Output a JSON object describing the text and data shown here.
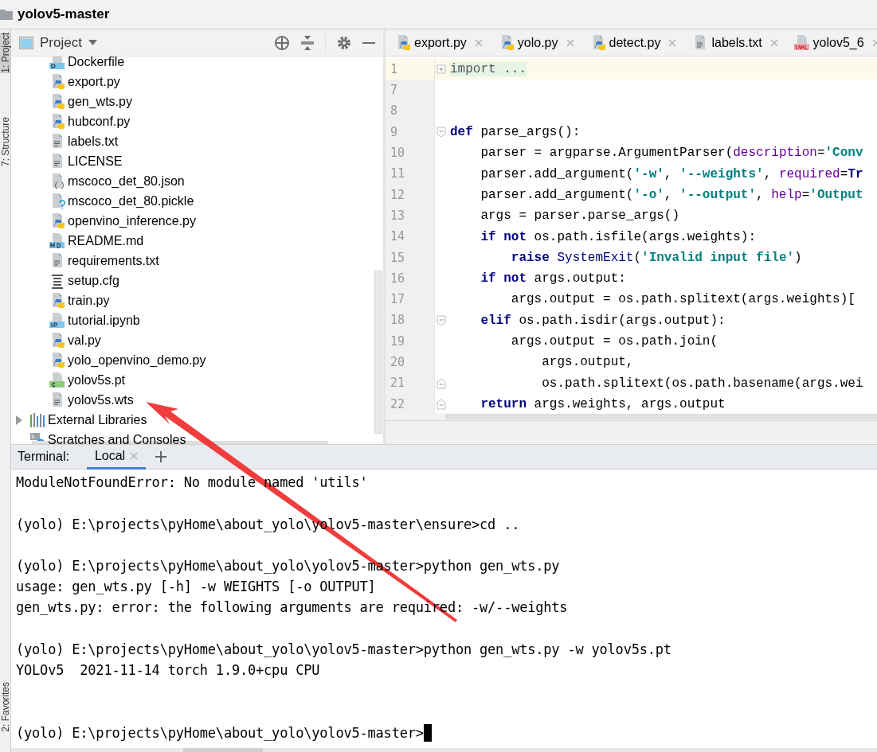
{
  "window": {
    "title": "yolov5-master"
  },
  "tool_stripe": [
    {
      "label": "1: Project",
      "selected": true
    },
    {
      "label": "7: Structure",
      "selected": false
    },
    {
      "label": "2: Favorites",
      "selected": false
    }
  ],
  "project_panel": {
    "title": "Project",
    "files": [
      {
        "label": "Dockerfile",
        "kind": "docker"
      },
      {
        "label": "export.py",
        "kind": "python"
      },
      {
        "label": "gen_wts.py",
        "kind": "python"
      },
      {
        "label": "hubconf.py",
        "kind": "python"
      },
      {
        "label": "labels.txt",
        "kind": "text"
      },
      {
        "label": "LICENSE",
        "kind": "text"
      },
      {
        "label": "mscoco_det_80.json",
        "kind": "json"
      },
      {
        "label": "mscoco_det_80.pickle",
        "kind": "unknown"
      },
      {
        "label": "openvino_inference.py",
        "kind": "python"
      },
      {
        "label": "README.md",
        "kind": "markdown"
      },
      {
        "label": "requirements.txt",
        "kind": "text"
      },
      {
        "label": "setup.cfg",
        "kind": "config"
      },
      {
        "label": "train.py",
        "kind": "python"
      },
      {
        "label": "tutorial.ipynb",
        "kind": "notebook"
      },
      {
        "label": "val.py",
        "kind": "python"
      },
      {
        "label": "yolo_openvino_demo.py",
        "kind": "python"
      },
      {
        "label": "yolov5s.pt",
        "kind": "binary"
      },
      {
        "label": "yolov5s.wts",
        "kind": "text"
      }
    ],
    "roots": [
      {
        "label": "External Libraries",
        "kind": "library",
        "expanded": false
      },
      {
        "label": "Scratches and Consoles",
        "kind": "scratches"
      }
    ]
  },
  "editor": {
    "tabs": [
      {
        "label": "export.py",
        "kind": "python"
      },
      {
        "label": "yolo.py",
        "kind": "python"
      },
      {
        "label": "detect.py",
        "kind": "python"
      },
      {
        "label": "labels.txt",
        "kind": "text"
      },
      {
        "label": "yolov5_6",
        "kind": "yaml"
      }
    ],
    "lines": [
      {
        "number": "1",
        "current": true,
        "collapsed": true,
        "segments": [
          {
            "kind": "folded",
            "text": "import ..."
          }
        ]
      },
      {
        "number": "7",
        "current": false
      },
      {
        "number": "8",
        "current": false
      },
      {
        "number": "9",
        "current": false,
        "fold_start": true,
        "segments": [
          {
            "kind": "keyword",
            "text": "def"
          },
          {
            "kind": "plain",
            "text": " parse_args():"
          }
        ]
      },
      {
        "number": "10",
        "current": false,
        "segments": [
          {
            "kind": "plain",
            "text": "    parser = argparse.ArgumentParser("
          },
          {
            "kind": "param",
            "text": "description"
          },
          {
            "kind": "plain",
            "text": "="
          },
          {
            "kind": "string",
            "text": "'Conv"
          }
        ]
      },
      {
        "number": "11",
        "current": false,
        "segments": [
          {
            "kind": "plain",
            "text": "    parser.add_argument("
          },
          {
            "kind": "string",
            "text": "'-w'"
          },
          {
            "kind": "plain",
            "text": ", "
          },
          {
            "kind": "string",
            "text": "'--weights'"
          },
          {
            "kind": "plain",
            "text": ", "
          },
          {
            "kind": "param",
            "text": "required"
          },
          {
            "kind": "plain",
            "text": "="
          },
          {
            "kind": "keyword",
            "text": "Tr"
          }
        ]
      },
      {
        "number": "12",
        "current": false,
        "segments": [
          {
            "kind": "plain",
            "text": "    parser.add_argument("
          },
          {
            "kind": "string",
            "text": "'-o'"
          },
          {
            "kind": "plain",
            "text": ", "
          },
          {
            "kind": "string",
            "text": "'--output'"
          },
          {
            "kind": "plain",
            "text": ", "
          },
          {
            "kind": "param",
            "text": "help"
          },
          {
            "kind": "plain",
            "text": "="
          },
          {
            "kind": "string",
            "text": "'Output"
          }
        ]
      },
      {
        "number": "13",
        "current": false,
        "segments": [
          {
            "kind": "plain",
            "text": "    args = parser.parse_args()"
          }
        ]
      },
      {
        "number": "14",
        "current": false,
        "segments": [
          {
            "kind": "keyword",
            "text": "    if not"
          },
          {
            "kind": "plain",
            "text": " os.path.isfile(args.weights):"
          }
        ]
      },
      {
        "number": "15",
        "current": false,
        "segments": [
          {
            "kind": "keyword",
            "text": "        raise"
          },
          {
            "kind": "builtin",
            "text": " SystemExit"
          },
          {
            "kind": "plain",
            "text": "("
          },
          {
            "kind": "string",
            "text": "'Invalid input file'"
          },
          {
            "kind": "plain",
            "text": ")"
          }
        ]
      },
      {
        "number": "16",
        "current": false,
        "segments": [
          {
            "kind": "keyword",
            "text": "    if not"
          },
          {
            "kind": "plain",
            "text": " args.output:"
          }
        ]
      },
      {
        "number": "17",
        "current": false,
        "segments": [
          {
            "kind": "plain",
            "text": "        args.output = os.path.splitext(args.weights)["
          }
        ]
      },
      {
        "number": "18",
        "current": false,
        "fold_start": true,
        "segments": [
          {
            "kind": "keyword",
            "text": "    elif"
          },
          {
            "kind": "plain",
            "text": " os.path.isdir(args.output):"
          }
        ]
      },
      {
        "number": "19",
        "current": false,
        "segments": [
          {
            "kind": "plain",
            "text": "        args.output = os.path.join("
          }
        ]
      },
      {
        "number": "20",
        "current": false,
        "segments": [
          {
            "kind": "plain",
            "text": "            args.output,"
          }
        ]
      },
      {
        "number": "21",
        "current": false,
        "fold_end": true,
        "segments": [
          {
            "kind": "plain",
            "text": "            os.path.splitext(os.path.basename(args.wei"
          }
        ]
      },
      {
        "number": "22",
        "current": false,
        "fold_end": true,
        "segments": [
          {
            "kind": "keyword",
            "text": "    return"
          },
          {
            "kind": "plain",
            "text": " args.weights, args.output"
          }
        ]
      }
    ]
  },
  "terminal": {
    "label": "Terminal:",
    "tabs": [
      {
        "label": "Local",
        "selected": true
      }
    ],
    "lines": [
      {
        "kind": "text",
        "text": "ModuleNotFoundError: No module named 'utils'"
      },
      {
        "kind": "blank"
      },
      {
        "kind": "text",
        "text": "(yolo) E:\\projects\\pyHome\\about_yolo\\yolov5-master\\ensure>cd .."
      },
      {
        "kind": "blank"
      },
      {
        "kind": "text",
        "text": "(yolo) E:\\projects\\pyHome\\about_yolo\\yolov5-master>python gen_wts.py"
      },
      {
        "kind": "text",
        "text": "usage: gen_wts.py [-h] -w WEIGHTS [-o OUTPUT]"
      },
      {
        "kind": "text",
        "text": "gen_wts.py: error: the following arguments are required: -w/--weights"
      },
      {
        "kind": "blank"
      },
      {
        "kind": "text",
        "text": "(yolo) E:\\projects\\pyHome\\about_yolo\\yolov5-master>python gen_wts.py -w yolov5s.pt"
      },
      {
        "kind": "text",
        "text": "YOLOv5  2021-11-14 torch 1.9.0+cpu CPU"
      },
      {
        "kind": "blank"
      },
      {
        "kind": "blank"
      },
      {
        "kind": "text",
        "text": "(yolo) E:\\projects\\pyHome\\about_yolo\\yolov5-master>",
        "cursor": true
      }
    ]
  }
}
